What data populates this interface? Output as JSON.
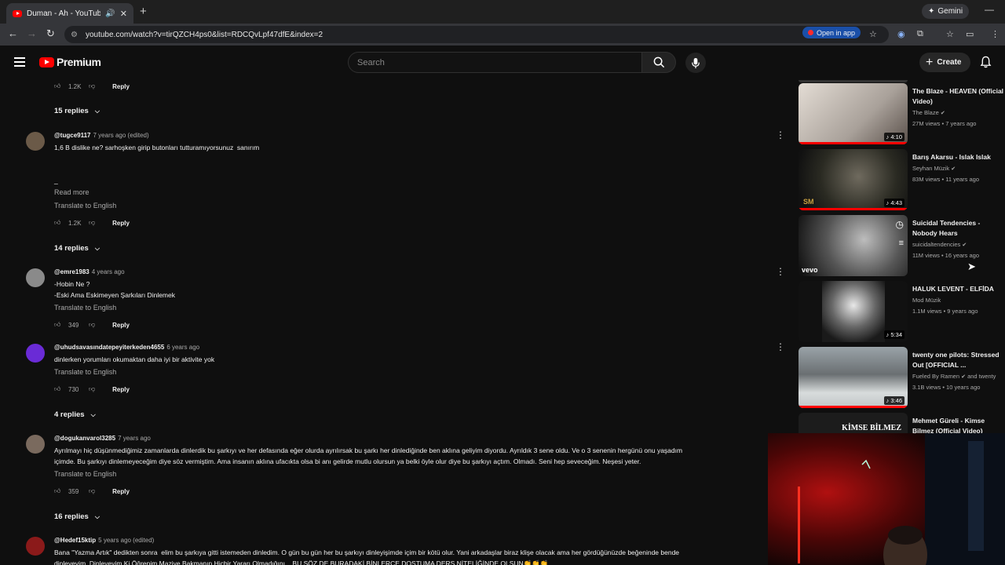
{
  "browser": {
    "tab_title": "Duman - Ah - YouTube",
    "new_tab_icon": "plus-icon",
    "gemini_label": "Gemini",
    "url": "youtube.com/watch?v=tirQZCH4ps0&list=RDCQvLpf47dfE&index=2",
    "open_in_app_label": "Open in app"
  },
  "youtube_header": {
    "logo_text": "Premium",
    "search_placeholder": "Search",
    "create_label": "Create"
  },
  "comments": {
    "top_partial": {
      "likes": "1.2K",
      "reply_label": "Reply"
    },
    "top_replies": "15 replies",
    "items": [
      {
        "author": "@tugce9117",
        "time": "7 years ago (edited)",
        "text": "1,6 B dislike ne? sarhoşken girip butonları tutturamıyorsunuz  sanırım\n\n\n_",
        "read_more": "Read more",
        "translate": "Translate to English",
        "likes": "1.2K",
        "reply_label": "Reply",
        "replies": "14 replies",
        "avatar_color": "#6b5a48"
      },
      {
        "author": "@emre1983",
        "time": "4 years ago",
        "text": "-Hobin Ne ?\n-Eski Ama Eskimeyen Şarkıları Dinlemek",
        "translate": "Translate to English",
        "likes": "349",
        "reply_label": "Reply",
        "avatar_color": "#8a8a8a"
      },
      {
        "author": "@uhudsavasındatepeyiterkeden4655",
        "time": "6 years ago",
        "text": "dinlerken yorumları okumaktan daha iyi bir aktivite yok",
        "translate": "Translate to English",
        "likes": "730",
        "reply_label": "Reply",
        "replies": "4 replies",
        "avatar_color": "#6a2bd6"
      },
      {
        "author": "@dogukanvarol3285",
        "time": "7 years ago",
        "text": "Ayrılmayı hiç düşünmediğimiz zamanlarda dinlerdik bu şarkıyı ve her defasında eğer olurda ayrılırsak bu şarkı her dinlediğinde ben aklına geliyim diyordu. Ayrıldık 3 sene oldu. Ve o 3 senenin hergünü onu yaşadım\niçimde. Bu şarkıyı dinlemeyeceğim diye söz vermiştim. Ama insanın aklına ufacıkta olsa bi anı gelirde mutlu olursun ya belki öyle olur diye bu şarkıyı açtım. Olmadı. Seni hep seveceğim. Neşesi yeter.",
        "translate": "Translate to English",
        "likes": "359",
        "reply_label": "Reply",
        "replies": "16 replies",
        "avatar_color": "#7a6a5e"
      },
      {
        "author": "@Hedef15ktip",
        "time": "5 years ago (edited)",
        "text": "Bana \"Yazma Artık\" dedikten sonra  elim bu şarkıya gitti istemeden dinledim. O gün bu gün her bu şarkıyı dinleyişimde içim bir kötü olur. Yani arkadaşlar biraz klişe olacak ama her gördüğünüzde beğeninde bende\ndinleyeyim. Dinleyeyim Ki Öğrenim Maziye Bakmanın Hiçbir Yararı Olmadığını... BU SÖZ DE BURADAKİ BİNLERCE DOSTUMA DERS NİTELİĞİNDE OLSUN👏👏👏",
        "avatar_color": "#8b1a1a"
      }
    ]
  },
  "sidebar": {
    "videos": [
      {
        "title": "The Blaze - HEAVEN (Official Video)",
        "channel": "The Blaze",
        "verified": true,
        "stats": "27M views • 7 years ago",
        "duration": "4:10",
        "progress": 1.0,
        "thumb_color": "#c8c0b8"
      },
      {
        "title": "Barış Akarsu - Islak Islak",
        "channel": "Seyhan Müzik",
        "verified": true,
        "stats": "83M views • 11 years ago",
        "duration": "4:43",
        "progress": 1.0,
        "thumb_color": "#2a2a22"
      },
      {
        "title": "Suicidal Tendencies - Nobody Hears",
        "channel": "suicidaltendencies",
        "verified": true,
        "stats": "11M views • 16 years ago",
        "duration": "",
        "progress": 0.0,
        "thumb_color": "#777777",
        "vevo": "vevo"
      },
      {
        "title": "HALUK LEVENT - ELFİDA",
        "channel": "Mod Müzik",
        "verified": false,
        "stats": "1.1M views • 9 years ago",
        "duration": "5:34",
        "progress": 0.0,
        "thumb_color": "#3a3a3a"
      },
      {
        "title": "twenty one pilots: Stressed Out [OFFICIAL ...",
        "channel": "Fueled By Ramen",
        "channel_extra": "and twenty",
        "verified": true,
        "stats": "3.1B views • 10 years ago",
        "duration": "3:46",
        "progress": 1.0,
        "thumb_color": "#6a6f72"
      },
      {
        "title": "Mehmet Güreli - Kimse Bilmez (Official Video)",
        "channel": "",
        "verified": false,
        "stats": "",
        "duration": "",
        "progress": 0.0,
        "thumb_color": "#222222",
        "thumb_text": "KİMSE BİLMEZ"
      }
    ]
  },
  "colors": {
    "background": "#0f0f0f",
    "brand_red": "#ff0000",
    "accent_blue": "#1a4fa8"
  }
}
